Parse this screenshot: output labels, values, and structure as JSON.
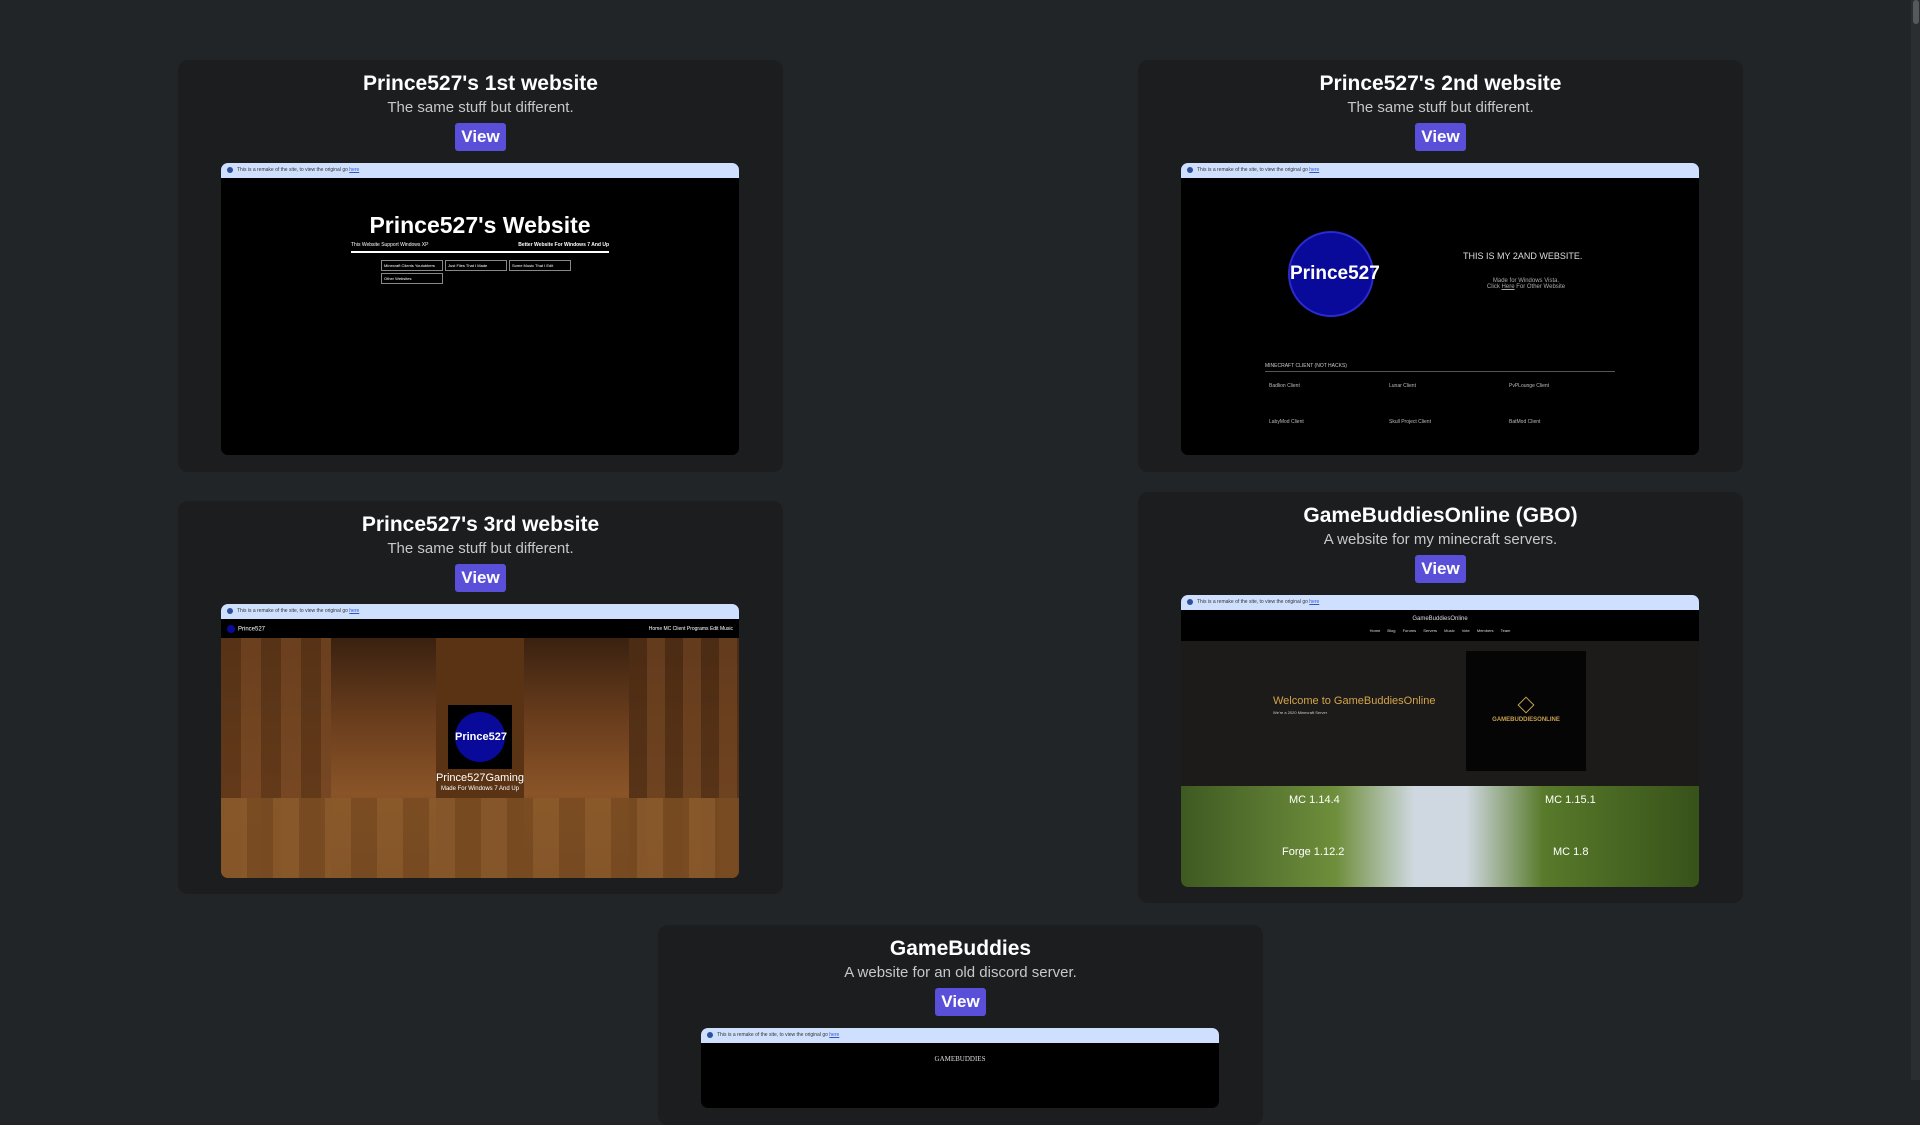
{
  "banner": {
    "text": "This is a remake of the site, to view the original go",
    "link": "here"
  },
  "cards": [
    {
      "title": "Prince527's 1st website",
      "desc": "The same stuff but different.",
      "view": "View",
      "preview": {
        "heading": "Prince527's Website",
        "left_note": "This Website Support Windows XP",
        "right_note": "Better Website For Windows 7 And Up",
        "buttons": [
          "Minecraft Clients Youtubbers",
          "Just Files That I Made",
          "Some Music That I Edit",
          "Other Websites"
        ]
      }
    },
    {
      "title": "Prince527's 2nd website",
      "desc": "The same stuff but different.",
      "view": "View",
      "preview": {
        "logo": "Prince527",
        "tagline": "THIS IS MY 2AND WEBSITE.",
        "sub1": "Made for Windows Vista.",
        "sub2_pre": "Click",
        "sub2_link": "Here",
        "sub2_post": "For Other Website",
        "section": "MINECRAFT CLIENT (NOT HACKS)",
        "clients": [
          "Badlion Client",
          "Lunar Client",
          "PvPLounge Client",
          "LabyMod Client",
          "Skull Project Client",
          "BatMod Client"
        ]
      }
    },
    {
      "title": "Prince527's 3rd website",
      "desc": "The same stuff but different.",
      "view": "View",
      "preview": {
        "brand": "Prince527",
        "nav": [
          "Home",
          "MC Client",
          "Programs",
          "Edit Music"
        ],
        "logo": "Prince527",
        "name": "Prince527Gaming",
        "sub": "Made For Windows 7 And Up"
      }
    },
    {
      "title": "GameBuddiesOnline (GBO)",
      "desc": "A website for my minecraft servers.",
      "view": "View",
      "preview": {
        "site": "GameBuddiesOnline",
        "nav": [
          "Home",
          "Blog",
          "Forums",
          "Servers",
          "Music",
          "Vote",
          "Members",
          "Team"
        ],
        "welcome": "Welcome to GameBuddiesOnline",
        "welcome_sub": "We're a 2020 Minecraft Server",
        "logo_text": "GAMEBUDDIESONLINE",
        "servers": [
          "MC 1.14.4",
          "MC 1.15.1",
          "Forge 1.12.2",
          "MC 1.8"
        ]
      }
    },
    {
      "title": "GameBuddies",
      "desc": "A website for an old discord server.",
      "view": "View",
      "preview": {
        "site": "GAMEBUDDIES"
      }
    }
  ],
  "colors": {
    "background": "#222527",
    "card": "#1b1d1f",
    "button": "#5a4fd8"
  }
}
